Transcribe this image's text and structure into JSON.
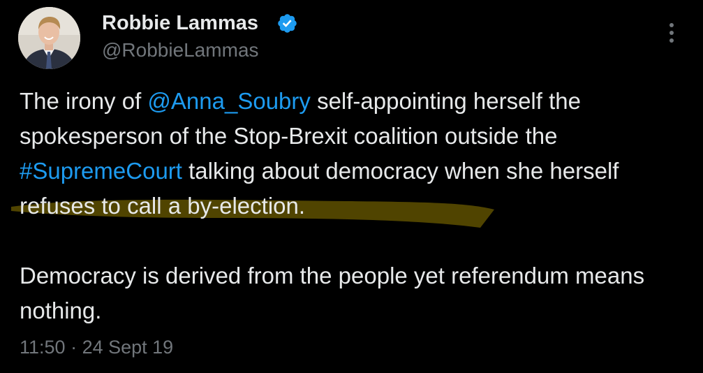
{
  "author": {
    "display_name": "Robbie Lammas",
    "handle": "@RobbieLammas",
    "verified_icon": "verified-badge-icon",
    "avatar_icon": "avatar-photo"
  },
  "tweet": {
    "paragraph_1": {
      "mention": "@Anna_Soubry",
      "text_after_mention": " self-appointing herself the spokesperson of the Stop-Brexit coalition outside the ",
      "hashtag": "#SupremeCourt",
      "text_after_hashtag": " talking about democracy when she herself refuses to call a by-election.",
      "prefix": "The irony of "
    },
    "paragraph_2": "Democracy is derived from the people yet referendum means nothing.",
    "highlighted_phrase": "herself refuses to call a by-election."
  },
  "meta": {
    "time": "11:50",
    "separator": " · ",
    "date": "24 Sept 19"
  },
  "menu": {
    "icon": "more-options-icon"
  },
  "colors": {
    "background": "#000000",
    "text": "#e7e9ea",
    "secondary": "#71767b",
    "link": "#1d9bf0",
    "verified": "#1d9bf0",
    "highlight": "#6b5a00"
  }
}
